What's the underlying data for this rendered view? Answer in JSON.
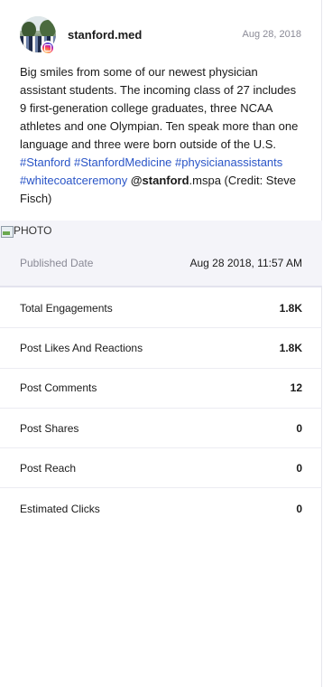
{
  "post": {
    "account": "stanford.med",
    "date_short": "Aug 28, 2018",
    "caption_text": "Big smiles from some of our newest physician assistant students. The incoming class of 27 includes 9 first-generation college graduates, three NCAA athletes and one Olympian. Ten speak more than one language and three were born outside of the U.S. ",
    "hashtags": [
      "#Stanford",
      "#StanfordMedicine",
      "#physicianassistants",
      "#whitecoatceremony"
    ],
    "mention_bold": "@stanford",
    "mention_rest": ".mspa (Credit: Steve Fisch)",
    "photo_alt": "PHOTO"
  },
  "published": {
    "label": "Published Date",
    "value": "Aug 28 2018, 11:57 AM"
  },
  "metrics": [
    {
      "label": "Total Engagements",
      "value": "1.8K"
    },
    {
      "label": "Post Likes And Reactions",
      "value": "1.8K"
    },
    {
      "label": "Post Comments",
      "value": "12"
    },
    {
      "label": "Post Shares",
      "value": "0"
    },
    {
      "label": "Post Reach",
      "value": "0"
    },
    {
      "label": "Estimated Clicks",
      "value": "0"
    }
  ]
}
